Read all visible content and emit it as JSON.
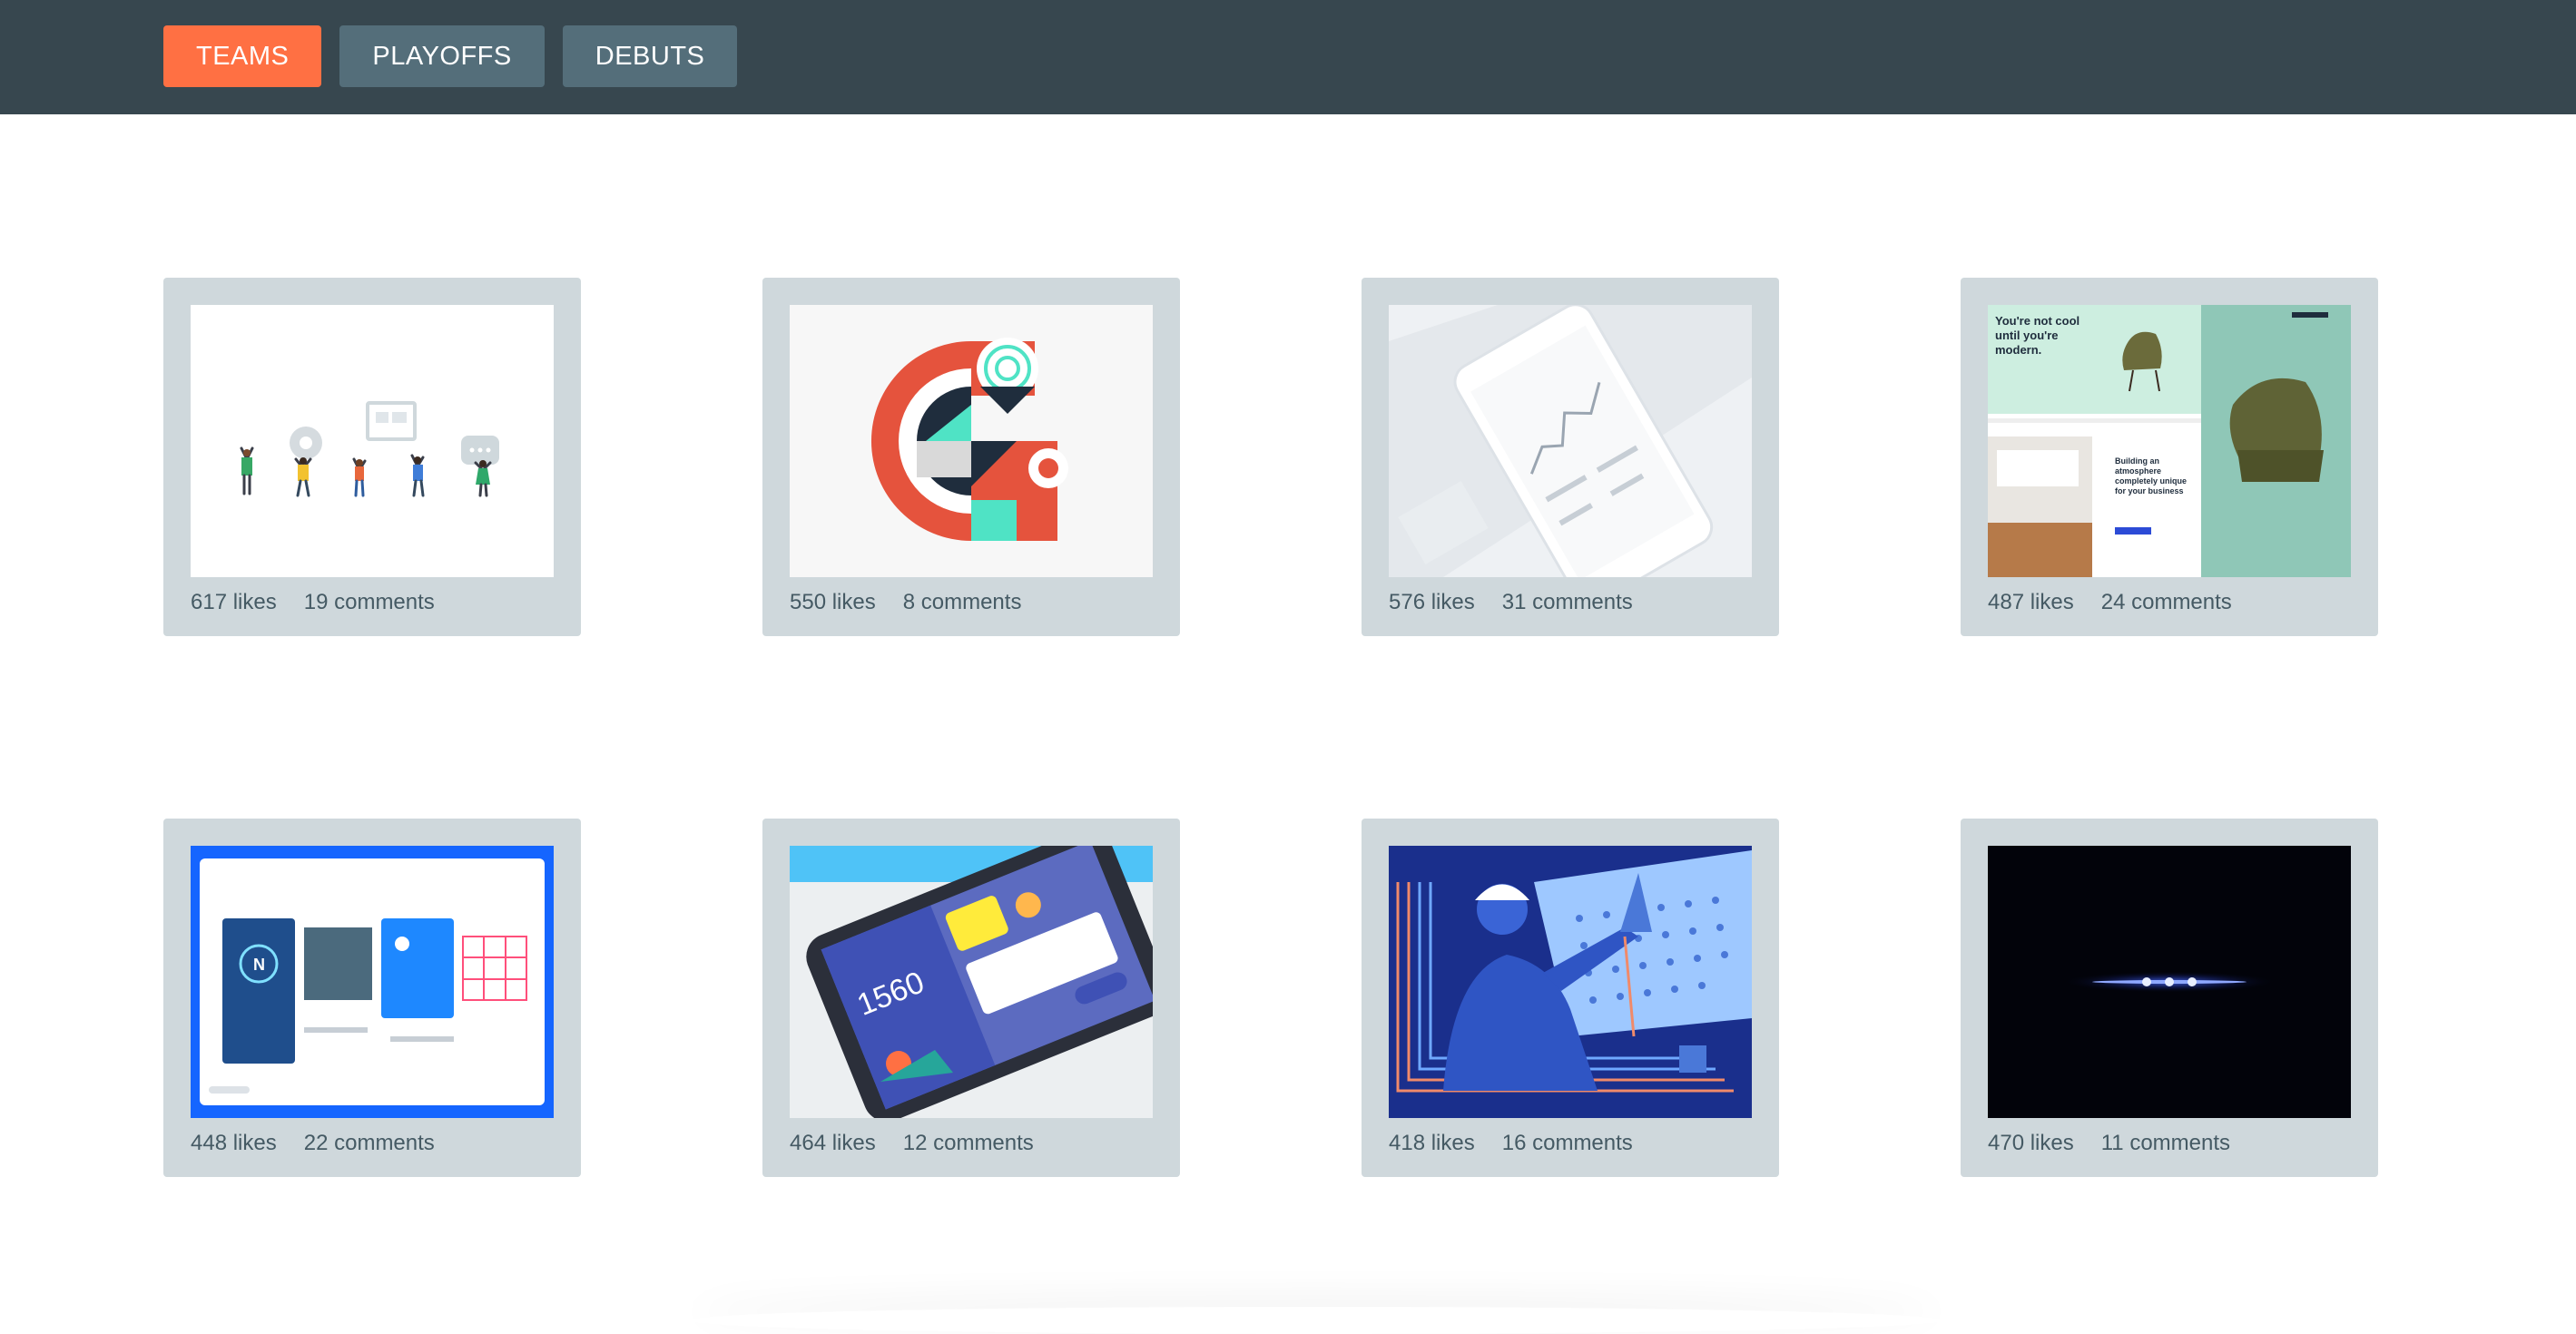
{
  "nav": {
    "tabs": [
      {
        "label": "TEAMS",
        "active": true
      },
      {
        "label": "PLAYOFFS",
        "active": false
      },
      {
        "label": "DEBUTS",
        "active": false
      }
    ]
  },
  "colors": {
    "header_bg": "#37474f",
    "active_tab": "#ff7043",
    "inactive_tab": "#546e7a",
    "card_bg": "#cfd8dc",
    "meta_text": "#455a64"
  },
  "shots": [
    {
      "thumbnail": "team-illustration",
      "likes": "617 likes",
      "comments": "19 comments"
    },
    {
      "thumbnail": "geometric-g",
      "likes": "550 likes",
      "comments": "8 comments"
    },
    {
      "thumbnail": "phone-chart",
      "likes": "576 likes",
      "comments": "31 comments"
    },
    {
      "thumbnail": "furniture-site",
      "headline": "You're not cool until you're modern.",
      "subhead": "Building an atmosphere completely unique for your business",
      "likes": "487 likes",
      "comments": "24 comments"
    },
    {
      "thumbnail": "app-wireframes",
      "likes": "448 likes",
      "comments": "22 comments"
    },
    {
      "thumbnail": "phone-app",
      "counter": "1560",
      "likes": "464 likes",
      "comments": "12 comments"
    },
    {
      "thumbnail": "engineer-illustration",
      "likes": "418 likes",
      "comments": "16 comments"
    },
    {
      "thumbnail": "dark-lights",
      "likes": "470 likes",
      "comments": "11 comments"
    }
  ]
}
